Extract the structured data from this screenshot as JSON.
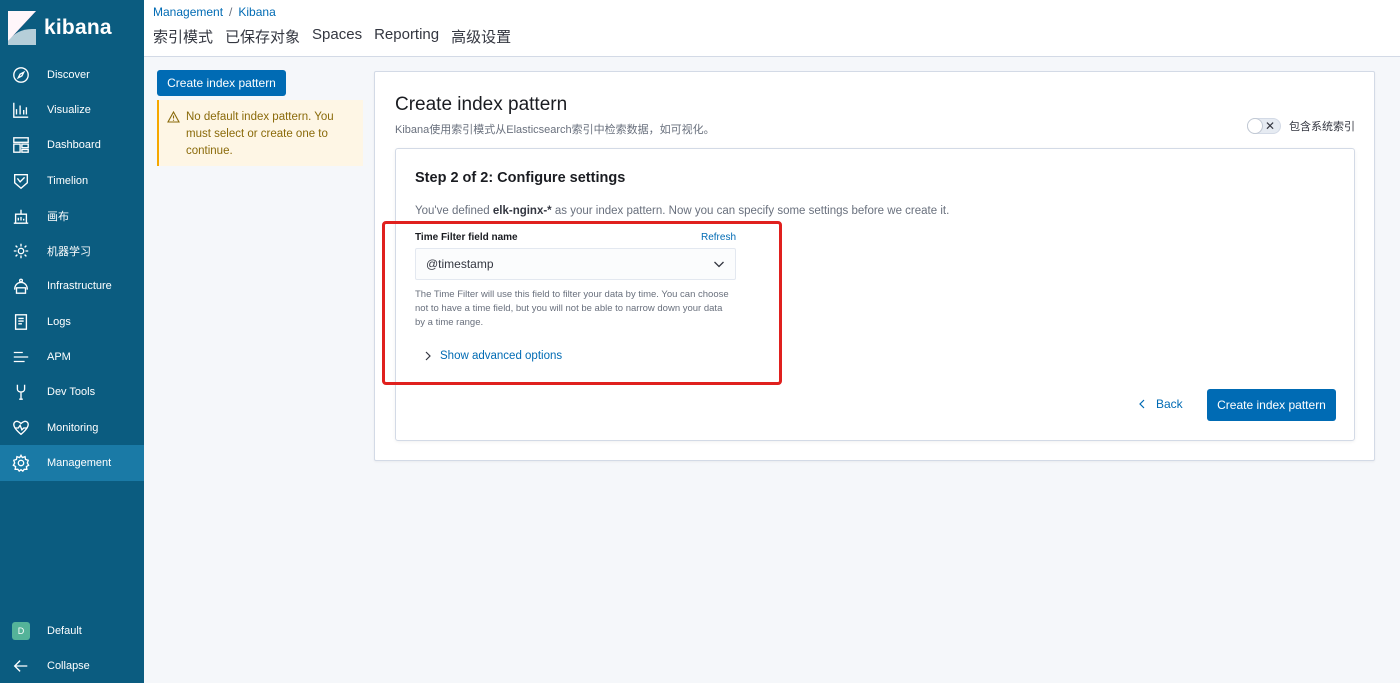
{
  "brand": {
    "name": "kibana"
  },
  "nav": {
    "items": [
      {
        "label": "Discover",
        "icon": "compass-icon"
      },
      {
        "label": "Visualize",
        "icon": "visualize-icon"
      },
      {
        "label": "Dashboard",
        "icon": "dashboard-icon"
      },
      {
        "label": "Timelion",
        "icon": "timelion-icon"
      },
      {
        "label": "画布",
        "icon": "canvas-icon"
      },
      {
        "label": "机器学习",
        "icon": "machine-learning-icon"
      },
      {
        "label": "Infrastructure",
        "icon": "infrastructure-icon"
      },
      {
        "label": "Logs",
        "icon": "logs-icon"
      },
      {
        "label": "APM",
        "icon": "apm-icon"
      },
      {
        "label": "Dev Tools",
        "icon": "dev-tools-icon"
      },
      {
        "label": "Monitoring",
        "icon": "monitoring-icon"
      },
      {
        "label": "Management",
        "icon": "gear-icon",
        "active": true
      }
    ],
    "space": {
      "badge": "D",
      "label": "Default"
    },
    "collapse": {
      "label": "Collapse"
    }
  },
  "header": {
    "breadcrumb": [
      "Management",
      "/",
      "Kibana"
    ],
    "tabs": [
      "索引模式",
      "已保存对象",
      "Spaces",
      "Reporting",
      "高级设置"
    ]
  },
  "left": {
    "create_button": "Create index pattern",
    "callout": "No default index pattern. You must select or create one to continue."
  },
  "panel": {
    "title": "Create index pattern",
    "description": "Kibana使用索引模式从Elasticsearch索引中检索数据，如可视化。",
    "toggle_label": "包含系统索引",
    "step": {
      "title": "Step 2 of 2: Configure settings",
      "desc_prefix": "You've defined ",
      "pattern": "elk-nginx-*",
      "desc_suffix": " as your index pattern. Now you can specify some settings before we create it.",
      "field_label": "Time Filter field name",
      "refresh": "Refresh",
      "selected_field": "@timestamp",
      "help": "The Time Filter will use this field to filter your data by time. You can choose not to have a time field, but you will not be able to narrow down your data by a time range.",
      "advanced": "Show advanced options",
      "back": "Back",
      "create": "Create index pattern"
    }
  },
  "colors": {
    "sidebar": "#0b5c80",
    "sidebar_active": "#1a7aa6",
    "primary": "#006bb4",
    "warning_bg": "#fef6e5",
    "highlight": "#e0201e"
  }
}
